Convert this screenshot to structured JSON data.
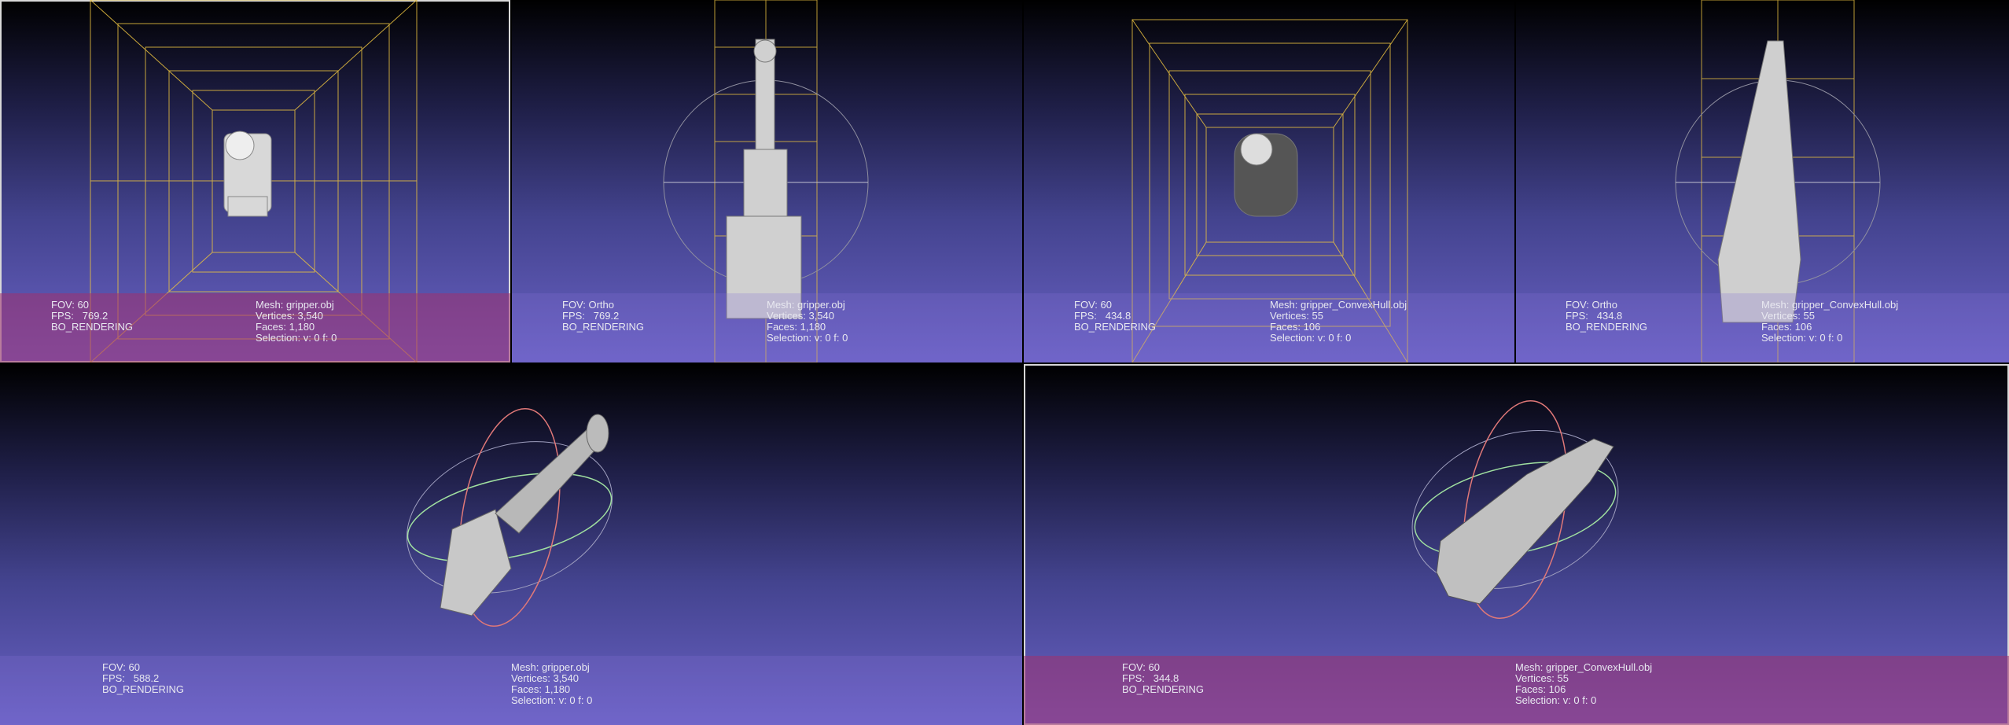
{
  "viewports": [
    {
      "id": "v1",
      "fov": "FOV: 60",
      "fps": "FPS:   769.2",
      "mode": "BO_RENDERING",
      "mesh": "Mesh: gripper.obj",
      "vertices": "Vertices: 3,540",
      "faces": "Faces: 1,180",
      "selection": "Selection: v: 0 f: 0",
      "selected": true
    },
    {
      "id": "v2",
      "fov": "FOV: Ortho",
      "fps": "FPS:   769.2",
      "mode": "BO_RENDERING",
      "mesh": "Mesh: gripper.obj",
      "vertices": "Vertices: 3,540",
      "faces": "Faces: 1,180",
      "selection": "Selection: v: 0 f: 0",
      "selected": false
    },
    {
      "id": "v3",
      "fov": "FOV: 60",
      "fps": "FPS:   434.8",
      "mode": "BO_RENDERING",
      "mesh": "Mesh: gripper_ConvexHull.obj",
      "vertices": "Vertices: 55",
      "faces": "Faces: 106",
      "selection": "Selection: v: 0 f: 0",
      "selected": false
    },
    {
      "id": "v4",
      "fov": "FOV: Ortho",
      "fps": "FPS:   434.8",
      "mode": "BO_RENDERING",
      "mesh": "Mesh: gripper_ConvexHull.obj",
      "vertices": "Vertices: 55",
      "faces": "Faces: 106",
      "selection": "Selection: v: 0 f: 0",
      "selected": false
    },
    {
      "id": "v5",
      "fov": "FOV: 60",
      "fps": "FPS:   588.2",
      "mode": "BO_RENDERING",
      "mesh": "Mesh: gripper.obj",
      "vertices": "Vertices: 3,540",
      "faces": "Faces: 1,180",
      "selection": "Selection: v: 0 f: 0",
      "selected": false
    },
    {
      "id": "v6",
      "fov": "FOV: 60",
      "fps": "FPS:   344.8",
      "mode": "BO_RENDERING",
      "mesh": "Mesh: gripper_ConvexHull.obj",
      "vertices": "Vertices: 55",
      "faces": "Faces: 106",
      "selection": "Selection: v: 0 f: 0",
      "selected": true
    }
  ],
  "colors": {
    "grid": "#e8c040",
    "trackball_red": "#e07878",
    "trackball_green": "#a0e0a0",
    "mesh": "#d0d0d0"
  },
  "icons": {
    "trackball": "trackball-gizmo",
    "grid": "bounding-grid"
  }
}
